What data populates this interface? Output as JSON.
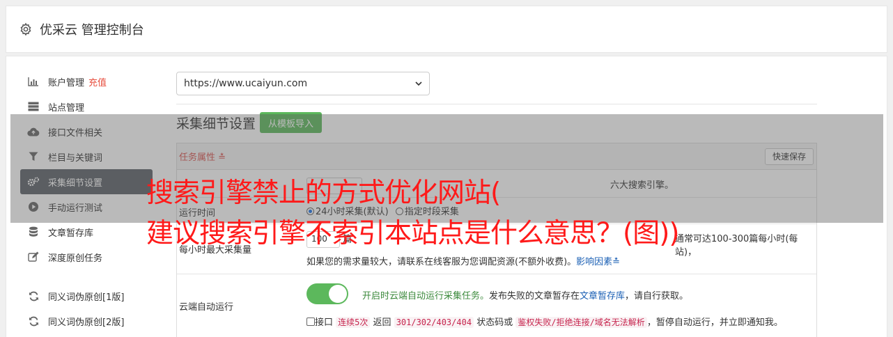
{
  "header": {
    "title": "优采云 管理控制台",
    "icon": "gear-icon"
  },
  "sidebar": {
    "items": [
      {
        "label": "账户管理",
        "badge": "充值",
        "icon": "bar-chart-icon"
      },
      {
        "label": "站点管理",
        "icon": "server-icon"
      },
      {
        "label": "接口文件相关",
        "icon": "cloud-upload-icon"
      },
      {
        "label": "栏目与关键词",
        "icon": "filter-icon"
      },
      {
        "label": "采集细节设置",
        "icon": "gears-icon",
        "active": true
      },
      {
        "label": "手动运行测试",
        "icon": "play-circle-icon"
      },
      {
        "label": "文章暂存库",
        "icon": "database-icon"
      },
      {
        "label": "深度原创任务",
        "icon": "edit-icon"
      },
      {
        "label": "同义词伪原创[1版]",
        "icon": "refresh-icon"
      },
      {
        "label": "同义词伪原创[2版]",
        "icon": "refresh-icon"
      }
    ]
  },
  "site_select": {
    "value": "https://www.ucaiyun.com"
  },
  "section": {
    "title": "采集细节设置",
    "import_button": "从模板导入"
  },
  "panel": {
    "task_label": "任务属性",
    "save_button": "快速保存",
    "row1": {
      "tail": "六大搜索引擎。"
    },
    "row2": {
      "label": "运行时间",
      "opt1": "24小时采集(默认)",
      "opt2": "指定时段采集"
    },
    "row3": {
      "label": "每小时最大采集量",
      "input": "100",
      "text_a": "篇",
      "text_b": "通常可达100-300篇每小时(每站)，",
      "text_c": "如果您的需求量较大，请联系在线客服为您调配资源(不额外收费)。",
      "link": "影响因素"
    },
    "row4": {
      "label": "云端自动运行",
      "toggle_on": true,
      "green_text": "开启时云端自动运行采集任务。",
      "text1": "发布失败的文章暂存在",
      "link": "文章暂存库",
      "text2": "，请自行获取。",
      "cb_text1": "接口",
      "code1": "连续5次",
      "cb_text2": "返回",
      "code2": "301/302/403/404",
      "cb_text3": "状态码或",
      "code3": "鉴权失败/拒绝连接/域名无法解析",
      "cb_text4": "，暂停自动运行，并立即通知我。"
    }
  },
  "watermark": {
    "line1": "搜索引擎禁止的方式优化网站(",
    "line2": "建议搜索引擎不索引本站点是什么意思？(图))"
  },
  "colors": {
    "active_nav": "#5c6168",
    "green": "#5cb85c",
    "red": "#ff1a1a",
    "link": "#1a5fb4"
  }
}
